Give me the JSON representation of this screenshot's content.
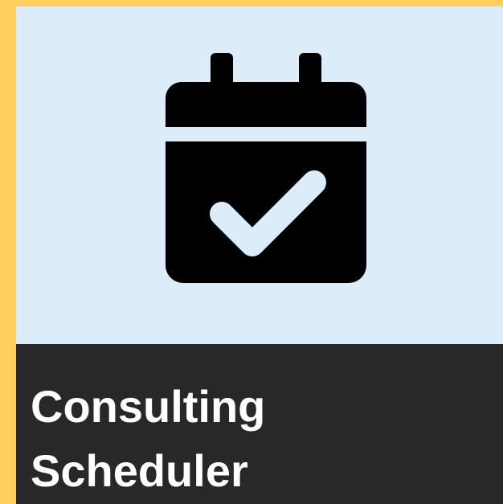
{
  "tile": {
    "label": "Consulting\nScheduler",
    "icon": "calendar-check-icon",
    "colors": {
      "border": "#ffd05e",
      "icon_background": "#dcecf9",
      "label_background": "#27282a",
      "label_text": "#ffffff",
      "icon": "#000000"
    }
  }
}
